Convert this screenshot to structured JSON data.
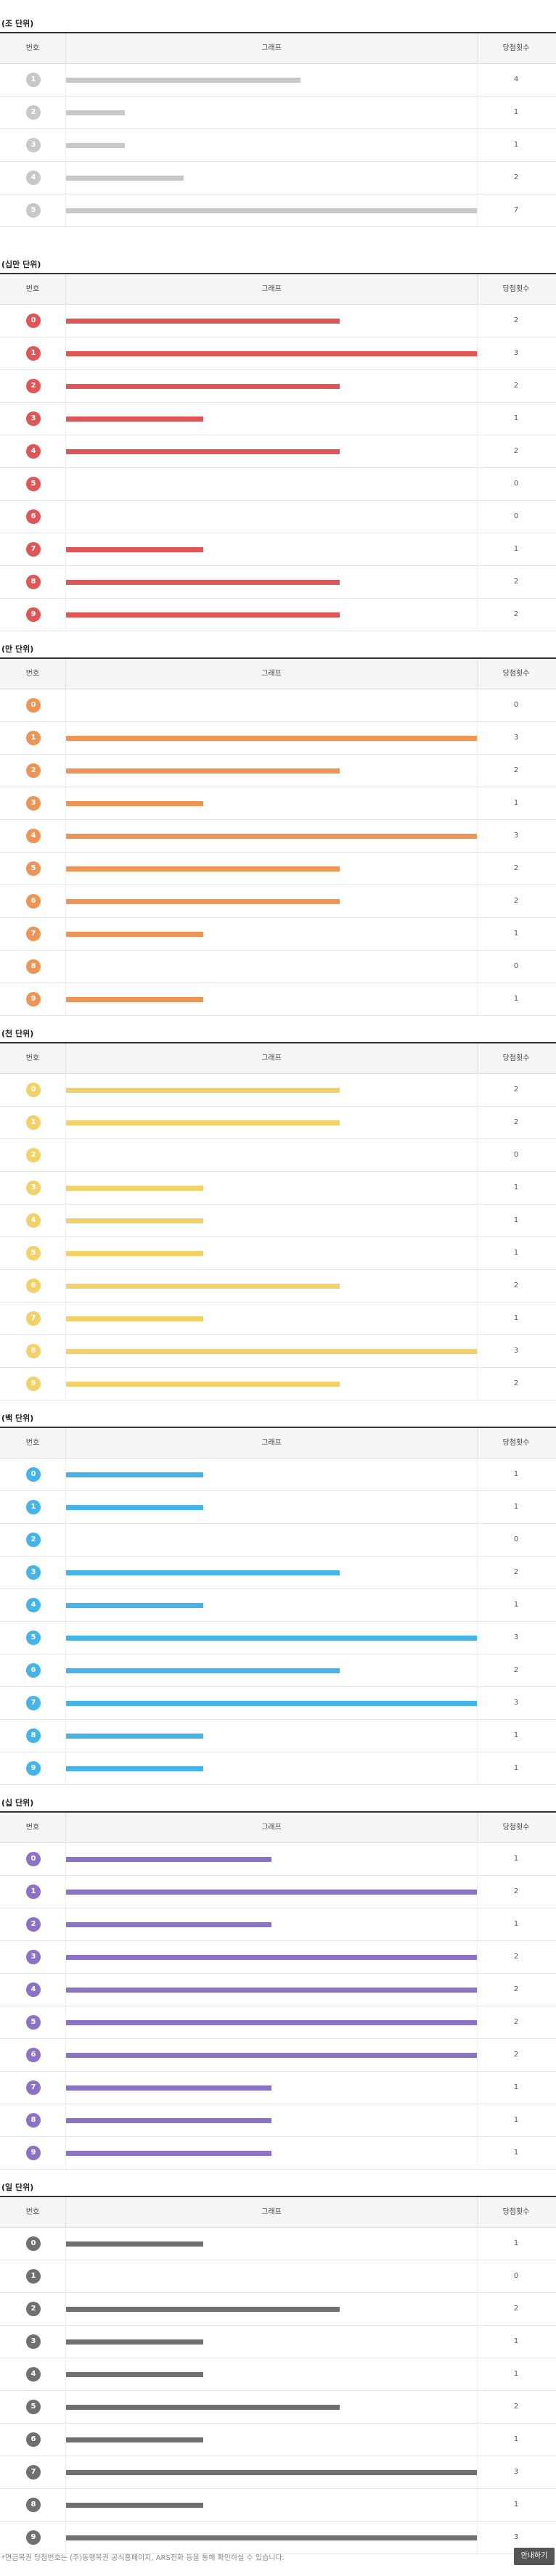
{
  "headers": {
    "number": "번호",
    "graph": "그래프",
    "count": "당첨횟수"
  },
  "footer": {
    "note": "*연금복권 당첨번호는 (주)동행복권 공식홈페이지, ARS전화 등을 통해 확인하실 수 있습니다.",
    "more_button": "안내하기"
  },
  "chart_data": [
    {
      "type": "bar",
      "title": "(조 단위)",
      "color": "#c8c8c8",
      "xmax": 7,
      "categories": [
        "1",
        "2",
        "3",
        "4",
        "5"
      ],
      "values": [
        4,
        1,
        1,
        2,
        7
      ]
    },
    {
      "type": "bar",
      "title": "(십만 단위)",
      "color": "#e05555",
      "xmax": 3,
      "categories": [
        "0",
        "1",
        "2",
        "3",
        "4",
        "5",
        "6",
        "7",
        "8",
        "9"
      ],
      "values": [
        2,
        3,
        2,
        1,
        2,
        0,
        0,
        1,
        2,
        2
      ]
    },
    {
      "type": "bar",
      "title": "(만 단위)",
      "color": "#ee9455",
      "xmax": 3,
      "categories": [
        "0",
        "1",
        "2",
        "3",
        "4",
        "5",
        "6",
        "7",
        "8",
        "9"
      ],
      "values": [
        0,
        3,
        2,
        1,
        3,
        2,
        2,
        1,
        0,
        1
      ]
    },
    {
      "type": "bar",
      "title": "(천 단위)",
      "color": "#f2d168",
      "xmax": 3,
      "categories": [
        "0",
        "1",
        "2",
        "3",
        "4",
        "5",
        "6",
        "7",
        "8",
        "9"
      ],
      "values": [
        2,
        2,
        0,
        1,
        1,
        1,
        2,
        1,
        3,
        2
      ]
    },
    {
      "type": "bar",
      "title": "(백 단위)",
      "color": "#45b4e8",
      "xmax": 3,
      "categories": [
        "0",
        "1",
        "2",
        "3",
        "4",
        "5",
        "6",
        "7",
        "8",
        "9"
      ],
      "values": [
        1,
        1,
        0,
        2,
        1,
        3,
        2,
        3,
        1,
        1
      ]
    },
    {
      "type": "bar",
      "title": "(십 단위)",
      "color": "#8a73c6",
      "xmax": 2,
      "categories": [
        "0",
        "1",
        "2",
        "3",
        "4",
        "5",
        "6",
        "7",
        "8",
        "9"
      ],
      "values": [
        1,
        2,
        1,
        2,
        2,
        2,
        2,
        1,
        1,
        1
      ]
    },
    {
      "type": "bar",
      "title": "(일 단위)",
      "color": "#707070",
      "xmax": 3,
      "categories": [
        "0",
        "1",
        "2",
        "3",
        "4",
        "5",
        "6",
        "7",
        "8",
        "9"
      ],
      "values": [
        1,
        0,
        2,
        1,
        1,
        2,
        1,
        3,
        1,
        3
      ]
    }
  ]
}
